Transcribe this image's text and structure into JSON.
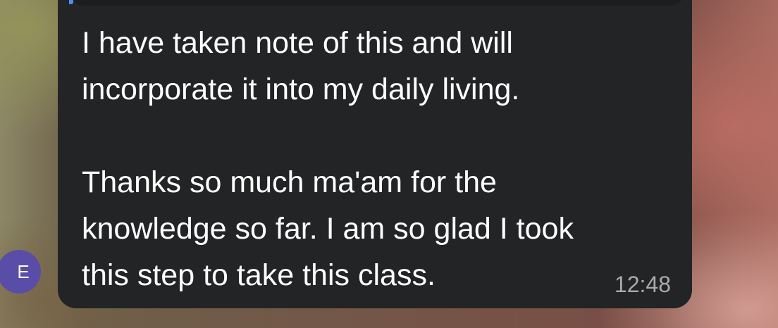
{
  "message": {
    "avatar_initial": "E",
    "paragraphs": [
      "I have taken note of this and will incorporate it into my daily living.",
      "Thanks so much ma'am for the knowledge so far. I am so glad I took this step to take this class."
    ],
    "lines": [
      "I have taken note of this and will",
      "incorporate it into my daily living.",
      "",
      "Thanks so much ma'am for the",
      "knowledge so far. I am so glad I took",
      "this step to take this class."
    ],
    "time": "12:48"
  },
  "colors": {
    "bubble": "#232425",
    "avatar": "#5a4da8",
    "text": "#ffffff",
    "timestamp": "#a9aaab",
    "reply_accent": "#4a8ef0"
  }
}
